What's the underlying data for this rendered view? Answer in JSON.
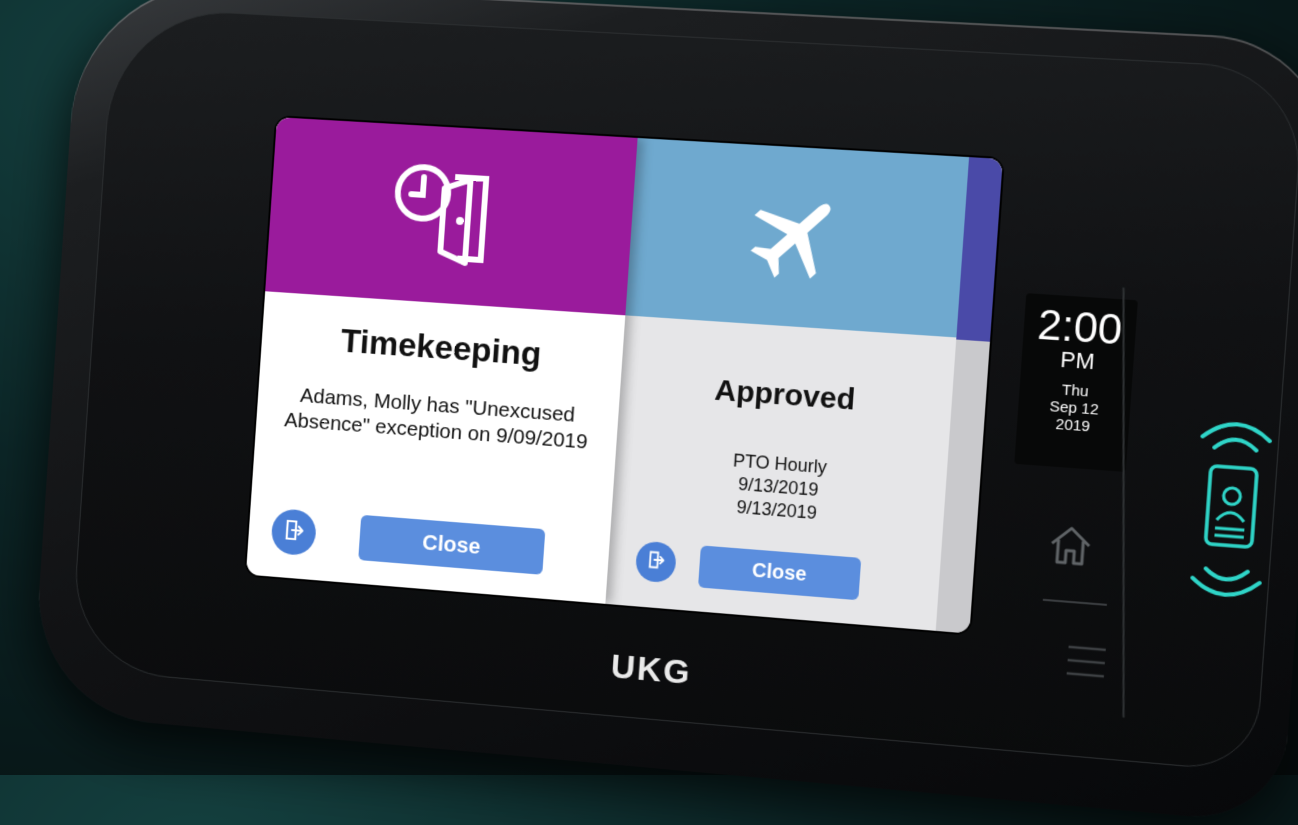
{
  "cards": [
    {
      "title": "Timekeeping",
      "body": "Adams, Molly has \"Unexcused Absence\" exception on 9/09/2019",
      "button_label": "Close",
      "banner_color": "#9a1b9c",
      "icon": "clock-door-icon"
    },
    {
      "title": "Approved",
      "body_lines": [
        "PTO Hourly",
        "9/13/2019",
        "9/13/2019"
      ],
      "button_label": "Close",
      "banner_color": "#6fa9cf",
      "icon": "airplane-icon"
    }
  ],
  "clock": {
    "time": "2:00",
    "ampm": "PM",
    "day": "Thu",
    "date": "Sep 12",
    "year": "2019"
  },
  "brand": {
    "logo": "UKG"
  },
  "icons": {
    "logout": "logout-icon",
    "home": "home-icon",
    "menu": "menu-icon",
    "badge": "badge-reader-icon"
  },
  "colors": {
    "accent_blue": "#5b8ede",
    "reader_teal": "#2fd5c8"
  }
}
